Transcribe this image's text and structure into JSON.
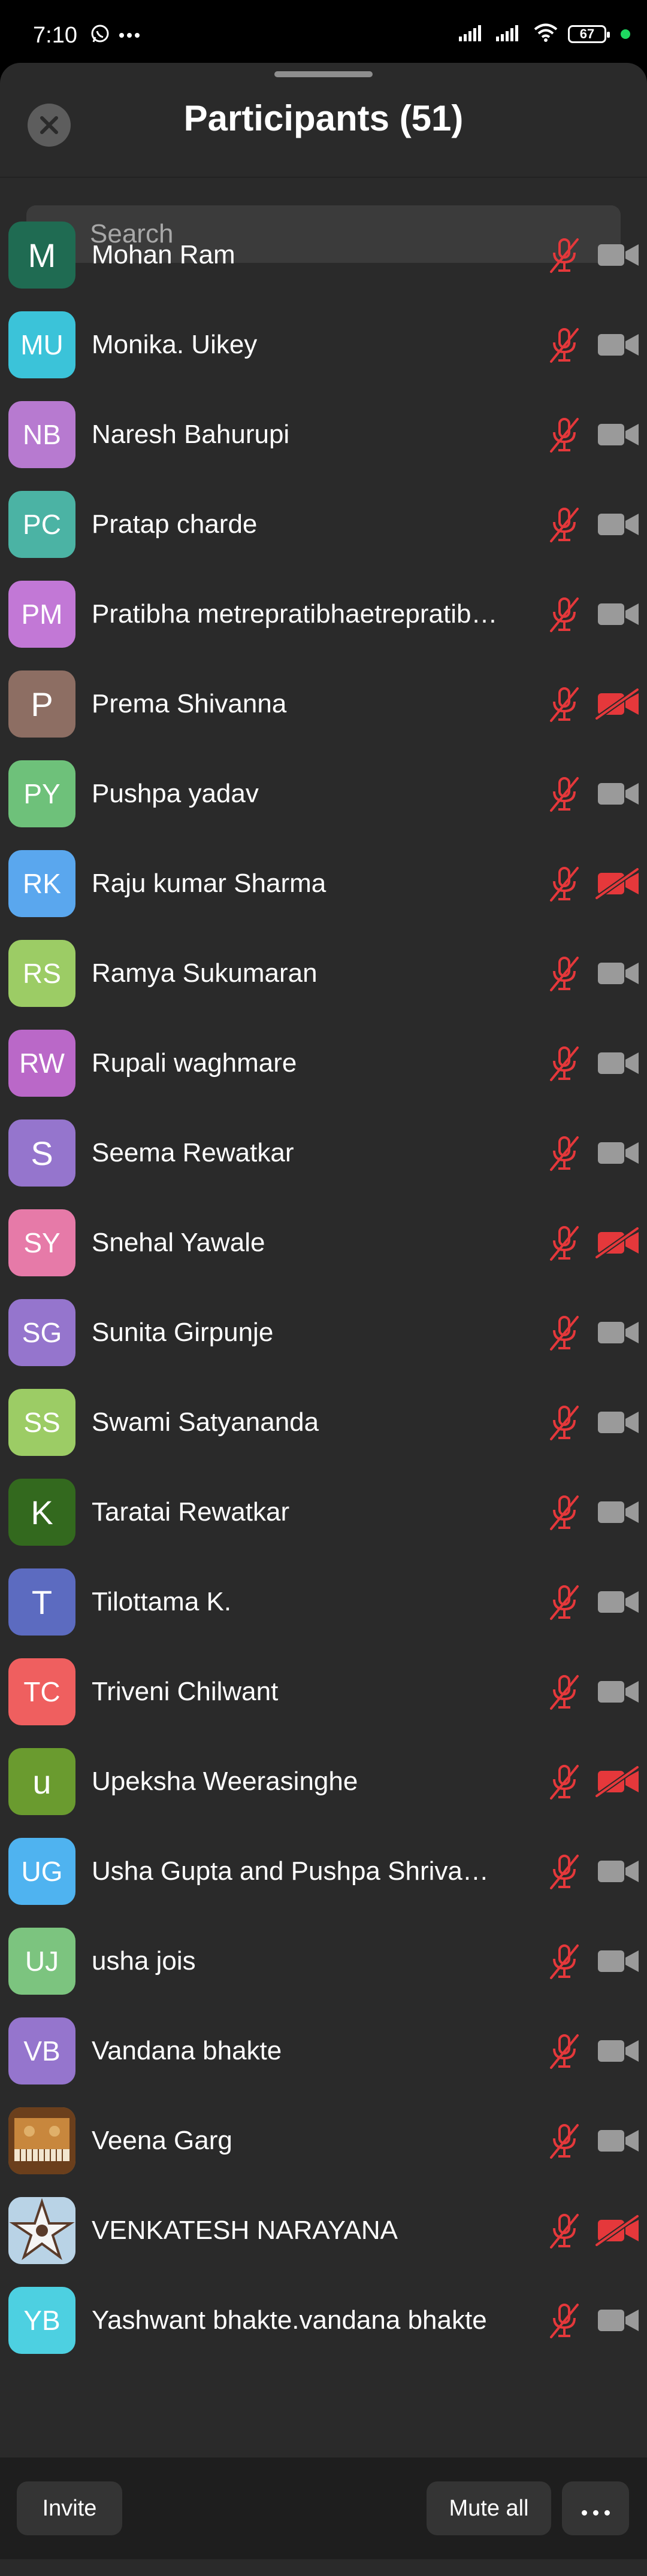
{
  "status_bar": {
    "time": "7:10",
    "battery": "67",
    "icons": [
      "whatsapp-icon",
      "more-dots-icon",
      "signal-icon",
      "signal-icon",
      "wifi-icon",
      "battery-icon"
    ]
  },
  "header": {
    "title": "Participants (51)"
  },
  "search": {
    "placeholder": "Search"
  },
  "participants": [
    {
      "initials": "M",
      "name": "Mohan Ram",
      "avatar_color": "#1f6b52",
      "video_off": false
    },
    {
      "initials": "MU",
      "name": "Monika. Uikey",
      "avatar_color": "#3bc3d9",
      "video_off": false
    },
    {
      "initials": "NB",
      "name": "Naresh Bahurupi",
      "avatar_color": "#b77ad0",
      "video_off": false
    },
    {
      "initials": "PC",
      "name": "Pratap charde",
      "avatar_color": "#4bb3a4",
      "video_off": false
    },
    {
      "initials": "PM",
      "name": "Pratibha metrepratibhaetrepratibhametre",
      "avatar_color": "#c278d6",
      "video_off": false
    },
    {
      "initials": "P",
      "name": "Prema Shivanna",
      "avatar_color": "#8d6e63",
      "video_off": true
    },
    {
      "initials": "PY",
      "name": "Pushpa yadav",
      "avatar_color": "#6ec17a",
      "video_off": false
    },
    {
      "initials": "RK",
      "name": "Raju kumar Sharma",
      "avatar_color": "#5aa7ee",
      "video_off": true
    },
    {
      "initials": "RS",
      "name": "Ramya Sukumaran",
      "avatar_color": "#9ccc65",
      "video_off": false
    },
    {
      "initials": "RW",
      "name": "Rupali waghmare",
      "avatar_color": "#ba68c8",
      "video_off": false
    },
    {
      "initials": "S",
      "name": "Seema  Rewatkar",
      "avatar_color": "#9575cd",
      "video_off": false
    },
    {
      "initials": "SY",
      "name": "Snehal Yawale",
      "avatar_color": "#e67aa8",
      "video_off": true
    },
    {
      "initials": "SG",
      "name": "Sunita Girpunje",
      "avatar_color": "#9575cd",
      "video_off": false
    },
    {
      "initials": "SS",
      "name": "Swami Satyananda",
      "avatar_color": "#9ccc65",
      "video_off": false
    },
    {
      "initials": "K",
      "name": "Taratai Rewatkar",
      "avatar_color": "#33691e",
      "video_off": false
    },
    {
      "initials": "T",
      "name": "Tilottama K.",
      "avatar_color": "#5c6bc0",
      "video_off": false
    },
    {
      "initials": "TC",
      "name": "Triveni Chilwant",
      "avatar_color": "#ef5f5f",
      "video_off": false
    },
    {
      "initials": "u",
      "name": "Upeksha Weerasinghe",
      "avatar_color": "#6a9b2f",
      "video_off": true
    },
    {
      "initials": "UG",
      "name": "Usha Gupta and Pushpa Shrivastava",
      "avatar_color": "#4fb3f0",
      "video_off": false
    },
    {
      "initials": "UJ",
      "name": "usha jois",
      "avatar_color": "#7cc47f",
      "video_off": false
    },
    {
      "initials": "VB",
      "name": "Vandana bhakte",
      "avatar_color": "#9575cd",
      "video_off": false
    },
    {
      "initials": "",
      "name": "Veena Garg",
      "avatar_color": "#c0843b",
      "avatar_image": "harmonium-photo",
      "video_off": false
    },
    {
      "initials": "",
      "name": "VENKATESH NARAYANA",
      "avatar_color": "#9fc3de",
      "avatar_image": "star-pattern-photo",
      "video_off": true
    },
    {
      "initials": "YB",
      "name": "Yashwant bhakte.vandana bhakte",
      "avatar_color": "#4dd0e1",
      "video_off": false
    }
  ],
  "footer": {
    "invite_label": "Invite",
    "mute_all_label": "Mute all",
    "more_icon": "more-horizontal-icon"
  },
  "colors": {
    "muted_red": "#e5383b",
    "camera_gray": "#9a9a9a",
    "sheet_bg": "#2a2a2a"
  }
}
